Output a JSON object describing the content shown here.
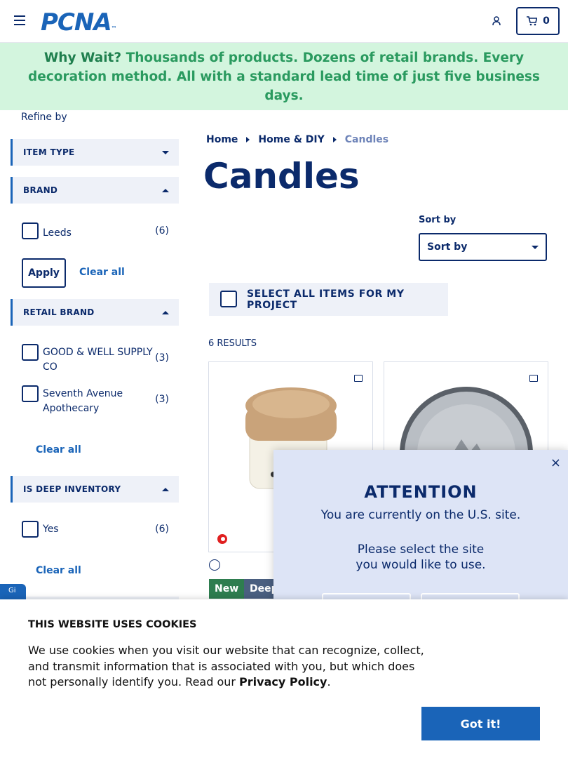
{
  "header": {
    "logo_text": "PCNA",
    "logo_mark": "™",
    "cart_count": "0"
  },
  "banner": {
    "lead": "Why Wait?",
    "text": " Thousands of products. Dozens of retail brands. Every decoration method. All with a standard lead time of just five business days."
  },
  "sidebar": {
    "refine_label": "Refine by",
    "facets": [
      {
        "label": "ITEM TYPE",
        "state": "collapsed"
      },
      {
        "label": "BRAND",
        "state": "expanded"
      },
      {
        "label": "RETAIL BRAND",
        "state": "expanded"
      },
      {
        "label": "IS DEEP INVENTORY",
        "state": "expanded"
      }
    ],
    "brand_options": [
      {
        "label": "Leeds",
        "count": "(6)"
      }
    ],
    "apply_label": "Apply",
    "clear_all_label": "Clear all",
    "retail_options": [
      {
        "label": "GOOD & WELL SUPPLY CO",
        "count": "(3)"
      },
      {
        "label": "Seventh Avenue Apothecary",
        "count": "(3)"
      }
    ],
    "deep_options": [
      {
        "label": "Yes",
        "count": "(6)"
      }
    ]
  },
  "breadcrumb": [
    "Home",
    "Home & DIY",
    "Candles"
  ],
  "page_title": "Candles",
  "sort": {
    "label": "Sort by",
    "value": "Sort by"
  },
  "select_all_label": "SELECT ALL ITEMS FOR MY PROJECT",
  "results_label": "6 RESULTS",
  "products": [
    {
      "badges": [
        "New",
        "Deep"
      ]
    },
    {
      "badges": []
    }
  ],
  "modal": {
    "title": "ATTENTION",
    "line1": "You are currently on the U.S. site.",
    "line2": "Please select the site you would like to use.",
    "close": "×"
  },
  "cookie": {
    "title": "THIS WEBSITE USES COOKIES",
    "text": "We use cookies when you visit our website that can recognize, collect, and transmit information that is associated with you, but which does not personally identify you. Read our ",
    "link": "Privacy Policy",
    "button": "Got it!"
  },
  "gift_tab": "Gi",
  "colors": {
    "brand": "#1a64b8",
    "navy": "#0b2a6b",
    "banner_bg": "#d3f5de",
    "banner_text": "#1f7f4e",
    "new_badge": "#2e7d4f",
    "deep_badge": "#4a5f80"
  }
}
